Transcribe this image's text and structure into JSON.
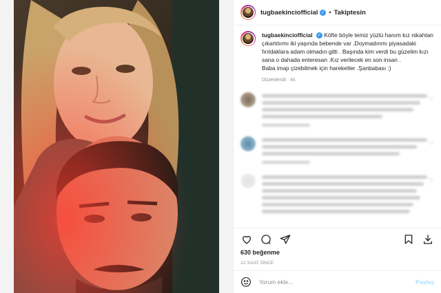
{
  "header": {
    "username": "tugbaekinciofficial",
    "separator": "•",
    "follow_label": "Takiptesin",
    "verified_icon": "verified-badge-icon"
  },
  "caption": {
    "username": "tugbaekinciofficial",
    "text": "Köfte böyle temiz yüzlü hanım kız nikahtan çıkartılırmı iki yaşında bebende var .Doymadınmı piyasadaki fırıldaklara adam olmadın gitti . Başında kim verdi bu güzelim kızı sana o dahada enteresan .Kız verilecek en son insan .",
    "text2": "Baba imajı çizebilmek için hareketler .Şanbabası :)",
    "meta": "Düzenlendi · 4s"
  },
  "actions": {
    "like_icon": "heart-icon",
    "comment_icon": "comment-icon",
    "share_icon": "paper-plane-icon",
    "save_icon": "bookmark-icon",
    "download_icon": "download-icon"
  },
  "likes": "630 beğenme",
  "timestamp": "12 SAAT ÖNCE",
  "add_comment": {
    "emoji_icon": "smiley-icon",
    "placeholder": "Yorum ekle...",
    "post_label": "Paylaş"
  },
  "colors": {
    "accent": "#0095f6",
    "post_disabled": "#b2dffc",
    "muted": "#8e8e8e"
  }
}
